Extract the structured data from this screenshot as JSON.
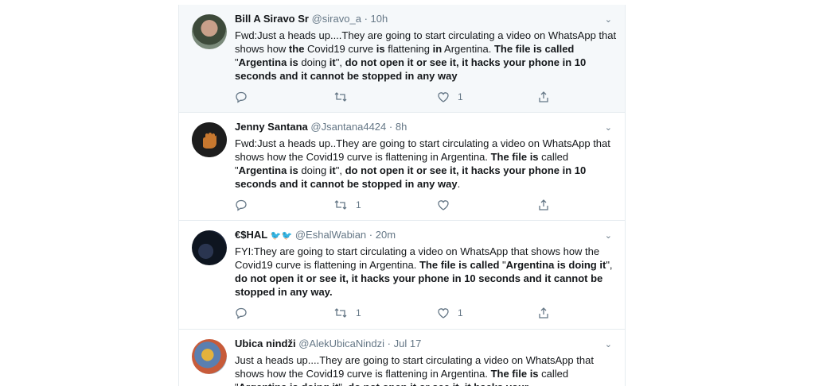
{
  "tweets": [
    {
      "name": "Bill A Siravo Sr",
      "handle": "@siravo_a",
      "dot": "·",
      "time": "10h",
      "body": [
        {
          "t": "Fwd:Just a heads up....They are going to start circulating a video on WhatsApp that shows how ",
          "b": false
        },
        {
          "t": "the",
          "b": true
        },
        {
          "t": " Covid19 curve ",
          "b": false
        },
        {
          "t": "is",
          "b": true
        },
        {
          "t": " flattening ",
          "b": false
        },
        {
          "t": "in",
          "b": true
        },
        {
          "t": " Argentina.  ",
          "b": false
        },
        {
          "t": "The file is called",
          "b": true
        },
        {
          "t": " \"",
          "b": false
        },
        {
          "t": "Argentina is",
          "b": true
        },
        {
          "t": " doing ",
          "b": false
        },
        {
          "t": "it",
          "b": true
        },
        {
          "t": "\", ",
          "b": false
        },
        {
          "t": "do not open it or see it, it hacks your phone in 10 seconds and it cannot be stopped in any way",
          "b": true
        }
      ],
      "reply_count": "",
      "retweet_count": "",
      "like_count": "1"
    },
    {
      "name": "Jenny Santana",
      "handle": "@Jsantana4424",
      "dot": "·",
      "time": "8h",
      "body": [
        {
          "t": "Fwd:Just a heads up..They are going to start circulating a video on WhatsApp that shows how the Covid19 curve is flattening in Argentina.  ",
          "b": false
        },
        {
          "t": "The file is",
          "b": true
        },
        {
          "t": " called \"",
          "b": false
        },
        {
          "t": "Argentina is",
          "b": true
        },
        {
          "t": " doing ",
          "b": false
        },
        {
          "t": "it",
          "b": true
        },
        {
          "t": "\", ",
          "b": false
        },
        {
          "t": "do not open it or see it, it hacks your phone in 10 seconds and it cannot be stopped in any way",
          "b": true
        },
        {
          "t": ".",
          "b": false
        }
      ],
      "reply_count": "",
      "retweet_count": "1",
      "like_count": ""
    },
    {
      "name": "€$HAL",
      "emoji": "🐦🐦",
      "handle": "@EshalWabian",
      "dot": "·",
      "time": "20m",
      "body": [
        {
          "t": "FYI:They are going to start circulating a video on WhatsApp that shows how the Covid19 curve is flattening in Argentina.  ",
          "b": false
        },
        {
          "t": "The file is called",
          "b": true
        },
        {
          "t": " \"",
          "b": false
        },
        {
          "t": "Argentina is doing it",
          "b": true
        },
        {
          "t": "\", ",
          "b": false
        },
        {
          "t": "do not open it or see it, it hacks your phone in 10 seconds and it cannot be stopped in any way.",
          "b": true
        }
      ],
      "reply_count": "",
      "retweet_count": "1",
      "like_count": "1"
    },
    {
      "name": "Ubica nindži",
      "handle": "@AlekUbicaNindzi",
      "dot": "·",
      "time": "Jul 17",
      "body": [
        {
          "t": "Just a heads up....They are going to start circulating a video on WhatsApp that shows how the Covid19 curve is flattening in Argentina.  ",
          "b": false
        },
        {
          "t": "The file is",
          "b": true
        },
        {
          "t": " called \"",
          "b": false
        },
        {
          "t": "Argentina is doing it",
          "b": true
        },
        {
          "t": "\", ",
          "b": false
        },
        {
          "t": "do not open it or see it, it hacks your",
          "b": true
        }
      ],
      "reply_count": "",
      "retweet_count": "",
      "like_count": ""
    }
  ],
  "icons": {
    "reply": "reply-icon",
    "retweet": "retweet-icon",
    "like": "heart-icon",
    "share": "share-icon",
    "more": "chevron-down-icon"
  },
  "colors": {
    "text": "#14171a",
    "secondary": "#657786",
    "border": "#e6ecf0",
    "highlight_bg": "#f5f8fa"
  }
}
